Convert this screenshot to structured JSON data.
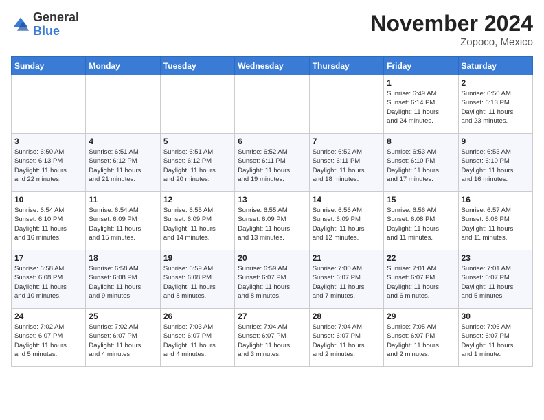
{
  "logo": {
    "general": "General",
    "blue": "Blue"
  },
  "title": "November 2024",
  "location": "Zopoco, Mexico",
  "days_of_week": [
    "Sunday",
    "Monday",
    "Tuesday",
    "Wednesday",
    "Thursday",
    "Friday",
    "Saturday"
  ],
  "weeks": [
    [
      {
        "day": "",
        "info": ""
      },
      {
        "day": "",
        "info": ""
      },
      {
        "day": "",
        "info": ""
      },
      {
        "day": "",
        "info": ""
      },
      {
        "day": "",
        "info": ""
      },
      {
        "day": "1",
        "info": "Sunrise: 6:49 AM\nSunset: 6:14 PM\nDaylight: 11 hours\nand 24 minutes."
      },
      {
        "day": "2",
        "info": "Sunrise: 6:50 AM\nSunset: 6:13 PM\nDaylight: 11 hours\nand 23 minutes."
      }
    ],
    [
      {
        "day": "3",
        "info": "Sunrise: 6:50 AM\nSunset: 6:13 PM\nDaylight: 11 hours\nand 22 minutes."
      },
      {
        "day": "4",
        "info": "Sunrise: 6:51 AM\nSunset: 6:12 PM\nDaylight: 11 hours\nand 21 minutes."
      },
      {
        "day": "5",
        "info": "Sunrise: 6:51 AM\nSunset: 6:12 PM\nDaylight: 11 hours\nand 20 minutes."
      },
      {
        "day": "6",
        "info": "Sunrise: 6:52 AM\nSunset: 6:11 PM\nDaylight: 11 hours\nand 19 minutes."
      },
      {
        "day": "7",
        "info": "Sunrise: 6:52 AM\nSunset: 6:11 PM\nDaylight: 11 hours\nand 18 minutes."
      },
      {
        "day": "8",
        "info": "Sunrise: 6:53 AM\nSunset: 6:10 PM\nDaylight: 11 hours\nand 17 minutes."
      },
      {
        "day": "9",
        "info": "Sunrise: 6:53 AM\nSunset: 6:10 PM\nDaylight: 11 hours\nand 16 minutes."
      }
    ],
    [
      {
        "day": "10",
        "info": "Sunrise: 6:54 AM\nSunset: 6:10 PM\nDaylight: 11 hours\nand 16 minutes."
      },
      {
        "day": "11",
        "info": "Sunrise: 6:54 AM\nSunset: 6:09 PM\nDaylight: 11 hours\nand 15 minutes."
      },
      {
        "day": "12",
        "info": "Sunrise: 6:55 AM\nSunset: 6:09 PM\nDaylight: 11 hours\nand 14 minutes."
      },
      {
        "day": "13",
        "info": "Sunrise: 6:55 AM\nSunset: 6:09 PM\nDaylight: 11 hours\nand 13 minutes."
      },
      {
        "day": "14",
        "info": "Sunrise: 6:56 AM\nSunset: 6:09 PM\nDaylight: 11 hours\nand 12 minutes."
      },
      {
        "day": "15",
        "info": "Sunrise: 6:56 AM\nSunset: 6:08 PM\nDaylight: 11 hours\nand 11 minutes."
      },
      {
        "day": "16",
        "info": "Sunrise: 6:57 AM\nSunset: 6:08 PM\nDaylight: 11 hours\nand 11 minutes."
      }
    ],
    [
      {
        "day": "17",
        "info": "Sunrise: 6:58 AM\nSunset: 6:08 PM\nDaylight: 11 hours\nand 10 minutes."
      },
      {
        "day": "18",
        "info": "Sunrise: 6:58 AM\nSunset: 6:08 PM\nDaylight: 11 hours\nand 9 minutes."
      },
      {
        "day": "19",
        "info": "Sunrise: 6:59 AM\nSunset: 6:08 PM\nDaylight: 11 hours\nand 8 minutes."
      },
      {
        "day": "20",
        "info": "Sunrise: 6:59 AM\nSunset: 6:07 PM\nDaylight: 11 hours\nand 8 minutes."
      },
      {
        "day": "21",
        "info": "Sunrise: 7:00 AM\nSunset: 6:07 PM\nDaylight: 11 hours\nand 7 minutes."
      },
      {
        "day": "22",
        "info": "Sunrise: 7:01 AM\nSunset: 6:07 PM\nDaylight: 11 hours\nand 6 minutes."
      },
      {
        "day": "23",
        "info": "Sunrise: 7:01 AM\nSunset: 6:07 PM\nDaylight: 11 hours\nand 5 minutes."
      }
    ],
    [
      {
        "day": "24",
        "info": "Sunrise: 7:02 AM\nSunset: 6:07 PM\nDaylight: 11 hours\nand 5 minutes."
      },
      {
        "day": "25",
        "info": "Sunrise: 7:02 AM\nSunset: 6:07 PM\nDaylight: 11 hours\nand 4 minutes."
      },
      {
        "day": "26",
        "info": "Sunrise: 7:03 AM\nSunset: 6:07 PM\nDaylight: 11 hours\nand 4 minutes."
      },
      {
        "day": "27",
        "info": "Sunrise: 7:04 AM\nSunset: 6:07 PM\nDaylight: 11 hours\nand 3 minutes."
      },
      {
        "day": "28",
        "info": "Sunrise: 7:04 AM\nSunset: 6:07 PM\nDaylight: 11 hours\nand 2 minutes."
      },
      {
        "day": "29",
        "info": "Sunrise: 7:05 AM\nSunset: 6:07 PM\nDaylight: 11 hours\nand 2 minutes."
      },
      {
        "day": "30",
        "info": "Sunrise: 7:06 AM\nSunset: 6:07 PM\nDaylight: 11 hours\nand 1 minute."
      }
    ]
  ]
}
